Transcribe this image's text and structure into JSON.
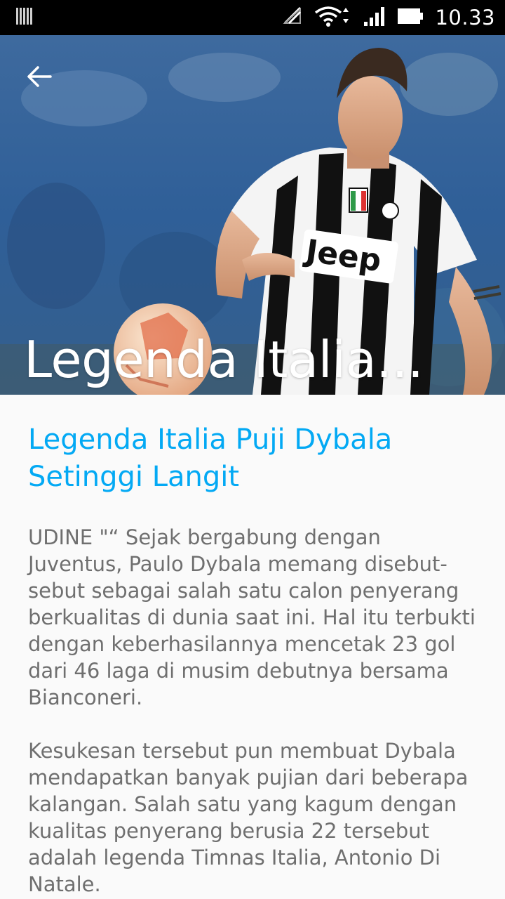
{
  "status_bar": {
    "time": "10.33",
    "icons": [
      "barcode-icon",
      "no-signal-icon",
      "wifi-icon",
      "cell-signal-icon",
      "battery-icon"
    ]
  },
  "hero": {
    "title": "Legenda Italia...",
    "back_icon": "arrow-left-icon"
  },
  "article": {
    "title": "Legenda Italia Puji Dybala Setinggi Langit",
    "paragraphs": [
      "UDINE \"“ Sejak bergabung dengan Juventus, Paulo Dybala memang disebut-sebut sebagai salah satu calon penyerang berkualitas di dunia saat ini. Hal itu terbukti dengan keberhasilannya mencetak 23 gol dari 46 laga di musim debutnya bersama Bianconeri.",
      " Kesukesan tersebut pun membuat Dybala mendapatkan banyak pujian dari beberapa kalangan. Salah satu yang kagum dengan kualitas penyerang berusia 22 tersebut adalah legenda Timnas Italia, Antonio Di Natale."
    ]
  },
  "colors": {
    "title_accent": "#03a9f4",
    "body_text": "#6f6f6f",
    "status_bar": "#000000",
    "background": "#fafafa"
  }
}
